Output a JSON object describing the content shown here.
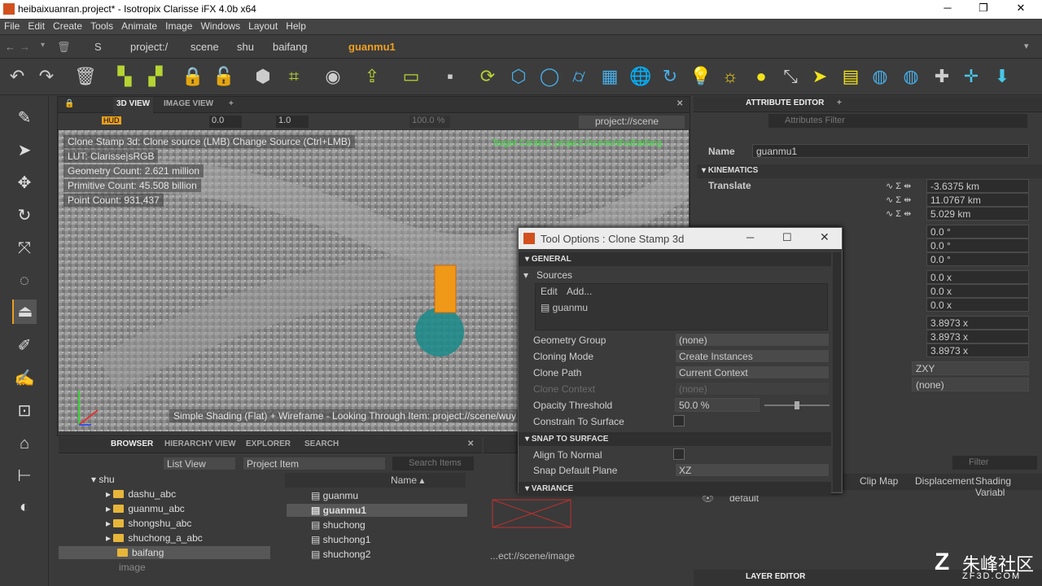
{
  "window": {
    "title": "heibaixuanran.project* - Isotropix Clarisse iFX 4.0b x64",
    "minimize": "─",
    "maximize": "❐",
    "close": "✕"
  },
  "menu": [
    "File",
    "Edit",
    "Create",
    "Tools",
    "Animate",
    "Image",
    "Windows",
    "Layout",
    "Help"
  ],
  "address": {
    "crumbs": [
      "project:/",
      "scene",
      "shu",
      "baifang"
    ],
    "current": "guanmu1"
  },
  "viewport_panel": {
    "tabs": [
      "3D VIEW",
      "IMAGE VIEW"
    ],
    "hud": "HUD",
    "field_a": "0.0",
    "field_b": "1.0",
    "field_c": "100.0 %",
    "context_path": "project://scene",
    "overlay": [
      "Clone Stamp 3d: Clone source (LMB)  Change Source (Ctrl+LMB)",
      "LUT: Clarisse|sRGB",
      "Geometry Count: 2.621 million",
      "Primitive Count: 45.508 billion",
      "Point Count: 931,437"
    ],
    "target": "Target Context: project://scene/shu/baifang",
    "status": "Simple Shading (Flat) + Wireframe - Looking Through Item: project://scene/wuy"
  },
  "tool_options": {
    "title": "Tool Options : Clone Stamp 3d",
    "general": "GENERAL",
    "sources_label": "Sources",
    "edit": "Edit",
    "add": "Add...",
    "source_item": "guanmu",
    "geometry_group": {
      "label": "Geometry Group",
      "value": "(none)"
    },
    "cloning_mode": {
      "label": "Cloning Mode",
      "value": "Create Instances"
    },
    "clone_path": {
      "label": "Clone Path",
      "value": "Current Context"
    },
    "clone_context": {
      "label": "Clone Context",
      "value": "(none)"
    },
    "opacity": {
      "label": "Opacity Threshold",
      "value": "50.0 %",
      "fraction": 0.5
    },
    "constrain": {
      "label": "Constrain To Surface"
    },
    "snap": "SNAP TO SURFACE",
    "align": {
      "label": "Align To Normal"
    },
    "snap_plane": {
      "label": "Snap Default Plane",
      "value": "XZ"
    },
    "variance": "VARIANCE"
  },
  "attr": {
    "tab": "ATTRIBUTE EDITOR",
    "filter": "Attributes Filter",
    "name_label": "Name",
    "name_value": "guanmu1",
    "kinematics": "KINEMATICS",
    "translate": "Translate",
    "translate_vals": [
      "-3.6375 km",
      "11.0767 km",
      "5.029 km"
    ],
    "rotate_vals": [
      "0.0 °",
      "0.0 °",
      "0.0 °"
    ],
    "offset_vals": [
      "0.0 x",
      "0.0 x",
      "0.0 x"
    ],
    "scale_vals": [
      "3.8973 x",
      "3.8973 x",
      "3.8973 x"
    ],
    "order": "ZXY",
    "parent": "(none)"
  },
  "lower_right": {
    "filter": "Filter",
    "cols": [
      "Clip Map",
      "Displacement",
      "Shading Variabl"
    ],
    "row": "default",
    "tab": "LAYER EDITOR"
  },
  "browser": {
    "tabs": [
      "BROWSER",
      "HIERARCHY VIEW",
      "EXPLORER",
      "SEARCH"
    ],
    "list_view": "List View",
    "project_item": "Project Item",
    "search": "Search Items",
    "name_col": "Name",
    "tree": [
      "shu",
      "dashu_abc",
      "guanmu_abc",
      "shongshu_abc",
      "shuchong_a_abc",
      "baifang",
      "image"
    ],
    "items": [
      "guanmu",
      "guanmu1",
      "shuchong",
      "shuchong1",
      "shuchong2"
    ]
  },
  "image_panel": {
    "path": "...ect://scene/image"
  },
  "watermark": {
    "brand": "朱峰社区",
    "url": "ZF3D.COM"
  }
}
